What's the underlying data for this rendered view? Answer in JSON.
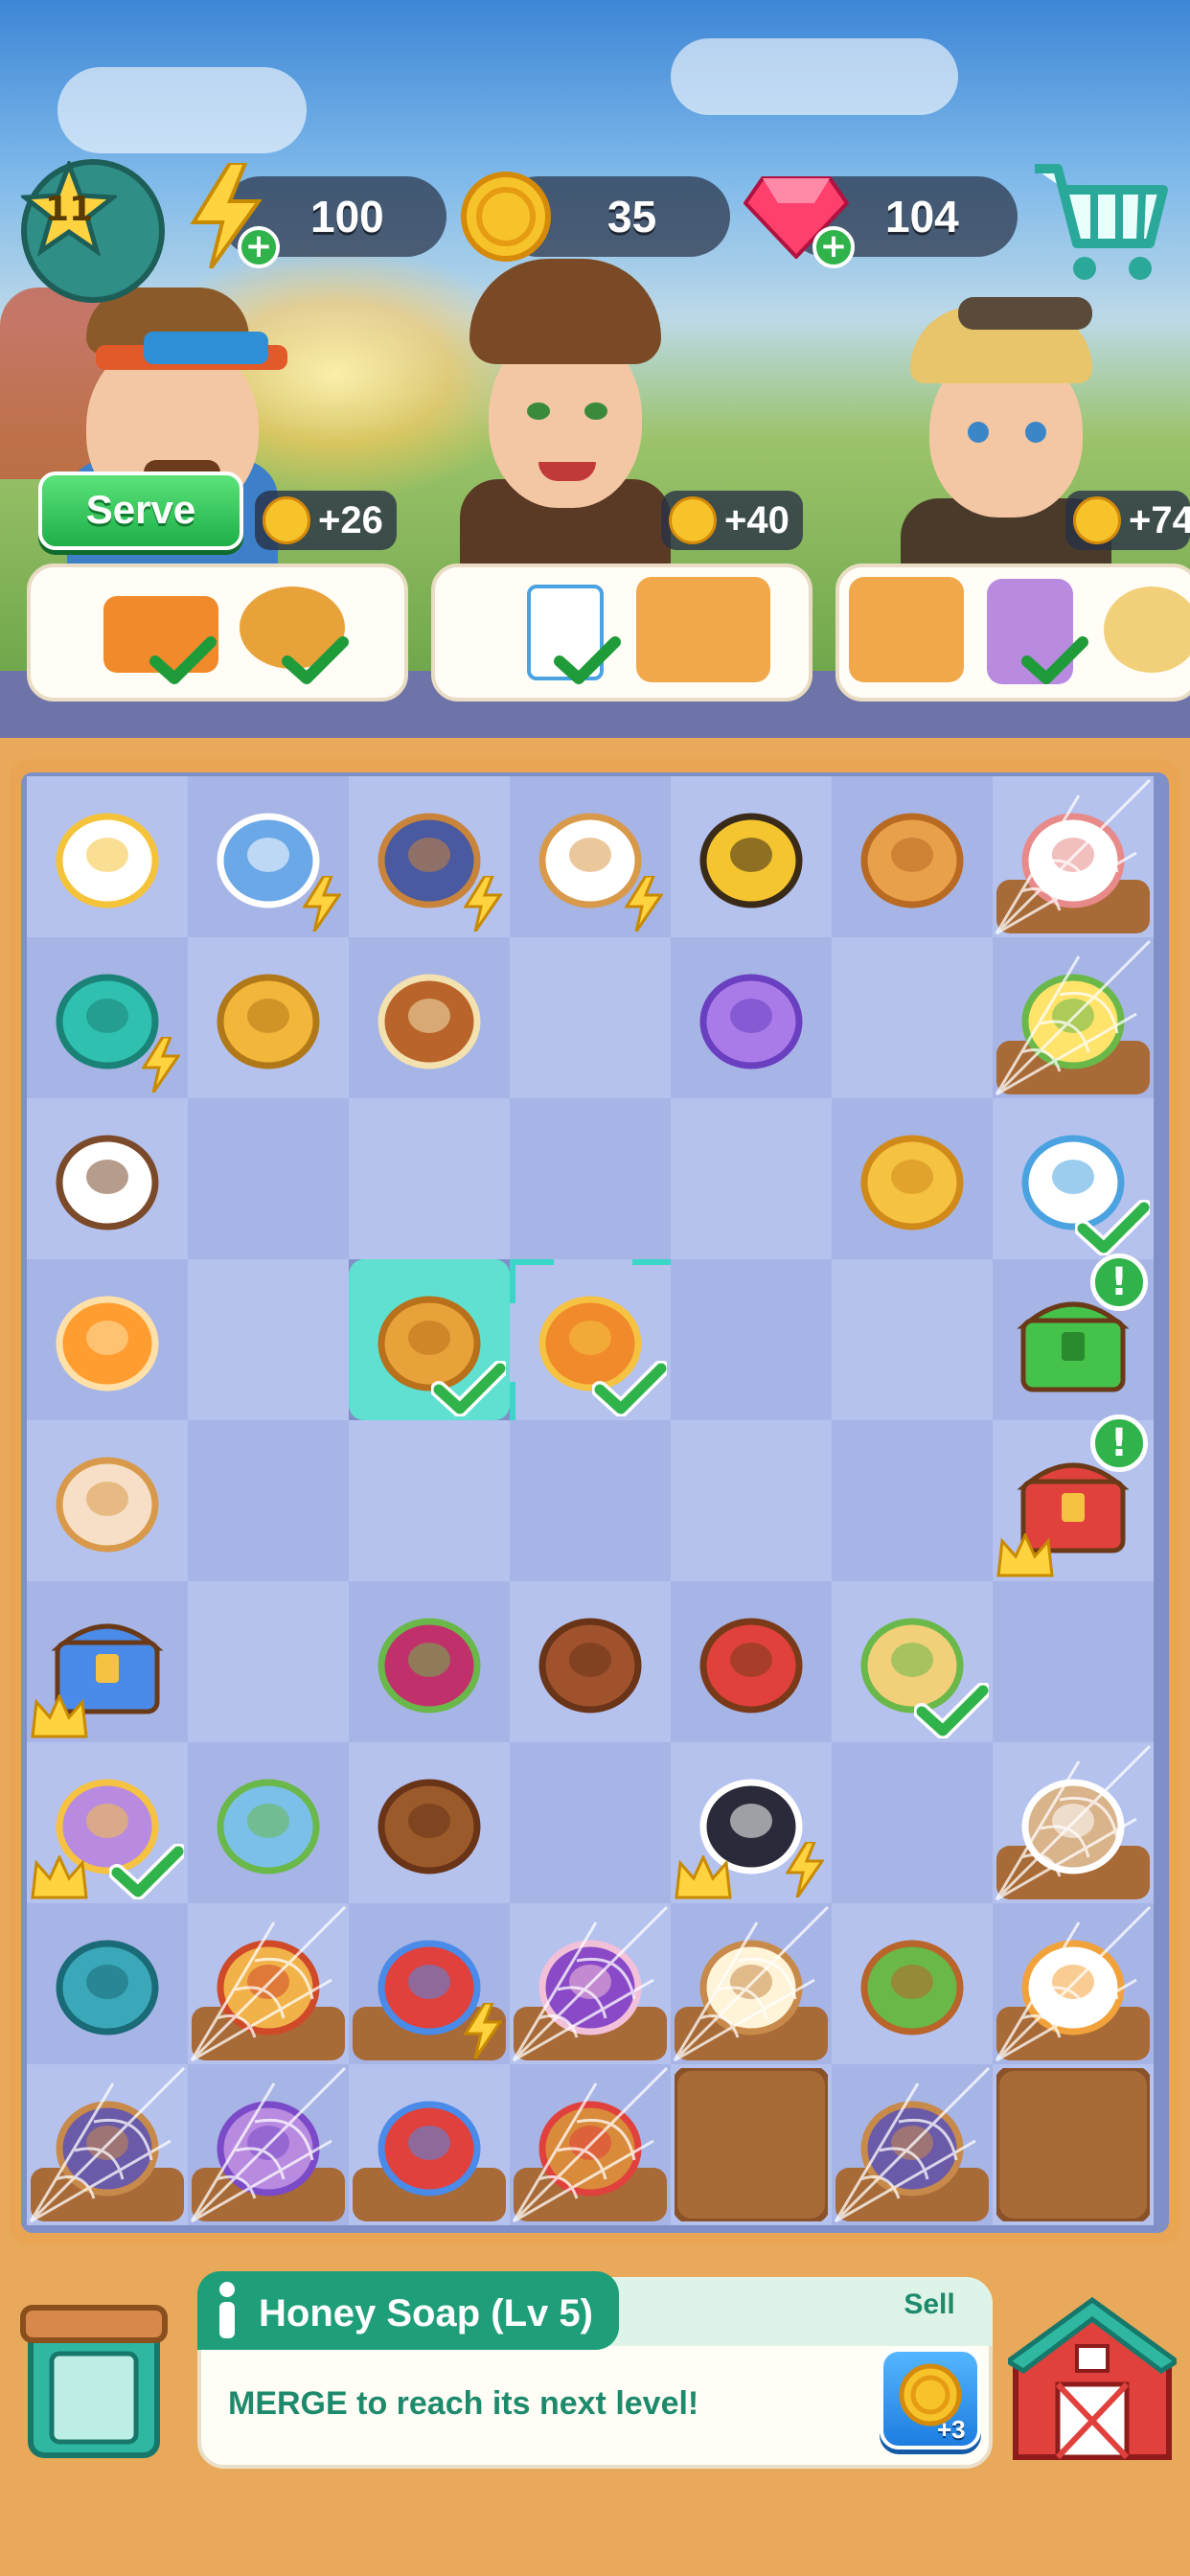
{
  "top_bar": {
    "level": "11",
    "energy": "100",
    "coins": "35",
    "gems": "104"
  },
  "customers": [
    {
      "reward": "+26",
      "has_serve": true
    },
    {
      "reward": "+40",
      "has_serve": false
    },
    {
      "reward": "+74",
      "has_serve": false
    }
  ],
  "serve_label": "Serve",
  "info": {
    "title": "Honey Soap (Lv 5)",
    "description": "MERGE to reach its next level!",
    "sell_label": "Sell",
    "sell_value": "+3"
  },
  "colors": {
    "board_light": "#b5c2ee",
    "board_dark": "#a7b4e6",
    "selected": "#5fe0d0",
    "accent_green": "#1f9e7a",
    "coin": "#f7c32a"
  },
  "board": {
    "cols": 7,
    "rows": 9,
    "items": [
      [
        "flower-daisy",
        "milk-coffee-pot",
        "coffee-grinder",
        "chicken-nest",
        "bee",
        "bread-ring",
        "photo-frame"
      ],
      [
        "toaster-oven",
        "beehive",
        "cutting-board",
        "",
        "purple-clogs",
        "",
        "omelette-plate"
      ],
      [
        "coffee-cup",
        "",
        "",
        "",
        "",
        "waffle-toast",
        "iced-coffee-cup"
      ],
      [
        "orange-juice",
        "",
        "bread-bun",
        "honey-soap",
        "",
        "",
        "green-chest"
      ],
      [
        "egg-nest",
        "",
        "",
        "",
        "",
        "",
        "red-chest"
      ],
      [
        "blue-chest",
        "",
        "berry-smoothie-jar",
        "chocolate-piece",
        "heart-chocolate-box",
        "sandwich-plate",
        ""
      ],
      [
        "purple-juice-pitcher",
        "folded-map",
        "cinnamon-sticks",
        "",
        "fried-egg-pan",
        "",
        "muffin-jar"
      ],
      [
        "whisk",
        "taco",
        "doghouse",
        "purple-dress",
        "note-paper",
        "green-handbag",
        "salad-plate"
      ],
      [
        "book-lamp",
        "sun-hat",
        "book-stack",
        "bagel-sandwich",
        "dirt-box",
        "book-lamp",
        "dirt-box"
      ]
    ]
  }
}
